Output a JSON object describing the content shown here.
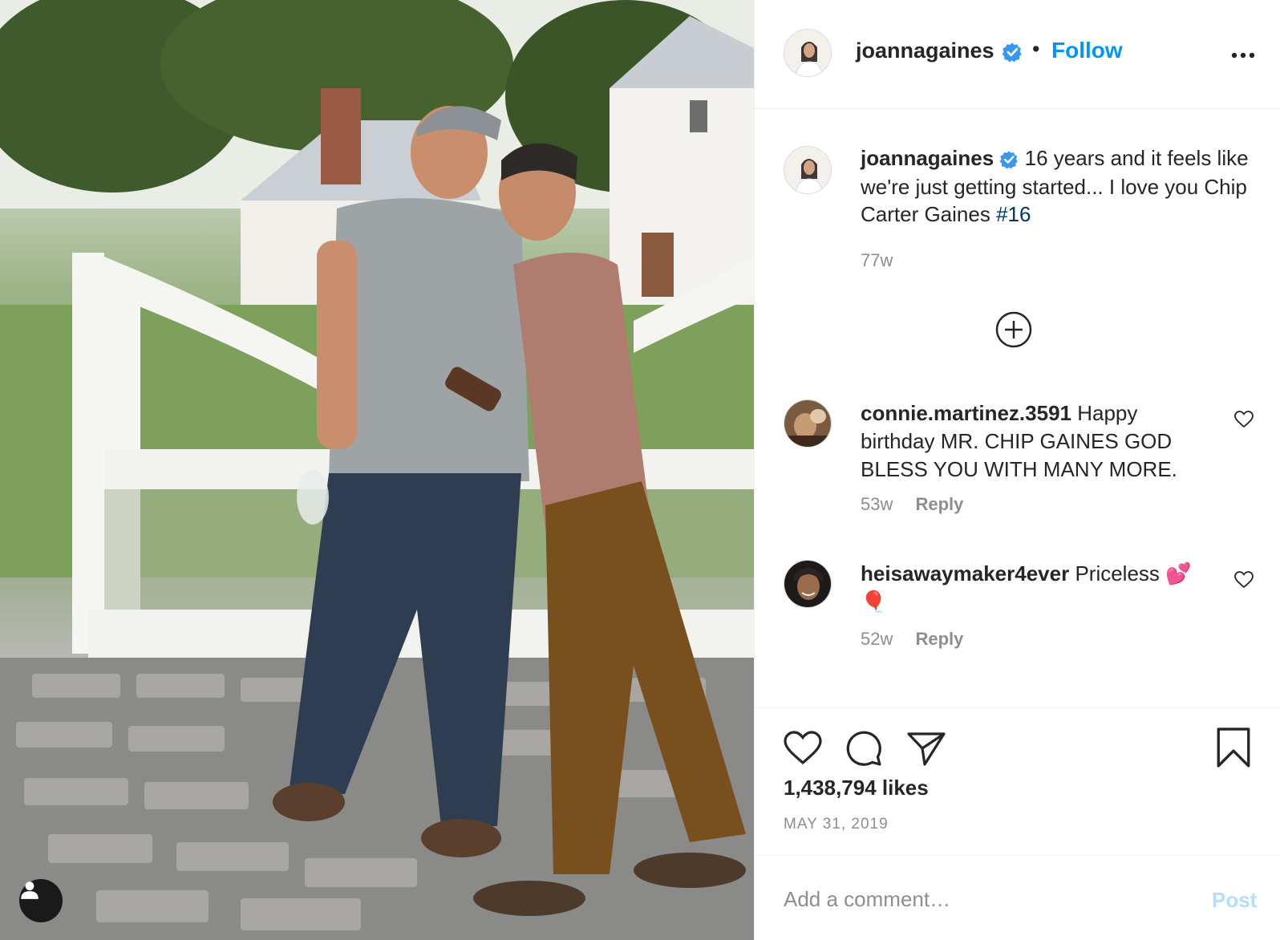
{
  "post": {
    "image_alt": "",
    "user_tag_icon": "person-icon"
  },
  "header": {
    "username": "joannagaines",
    "verified_icon": "verified-badge-icon",
    "separator": "•",
    "follow_label": "Follow",
    "more_icon": "more-options-icon"
  },
  "caption": {
    "username": "joannagaines",
    "text": "16 years and it feels like we're just getting started... I love you Chip Carter Gaines",
    "hashtag": "#16",
    "time": "77w"
  },
  "load_more_icon": "plus-circle-icon",
  "comments": [
    {
      "username": "connie.martinez.3591",
      "text": "Happy birthday MR. CHIP GAINES GOD BLESS YOU WITH MANY MORE.",
      "time": "53w",
      "reply_label": "Reply"
    },
    {
      "username": "heisawaymaker4ever",
      "text": "Priceless 💕🎈",
      "time": "52w",
      "reply_label": "Reply"
    }
  ],
  "actions": {
    "like_icon": "heart-icon",
    "comment_icon": "comment-icon",
    "share_icon": "share-icon",
    "save_icon": "bookmark-icon",
    "likes_text": "1,438,794 likes",
    "date": "MAY 31, 2019"
  },
  "comment_box": {
    "placeholder": "Add a comment…",
    "post_label": "Post"
  },
  "colors": {
    "accent": "#0095f6",
    "post_disabled": "#b2dffc",
    "hashtag": "#00376b",
    "muted": "#8e8e8e",
    "text": "#262626"
  }
}
